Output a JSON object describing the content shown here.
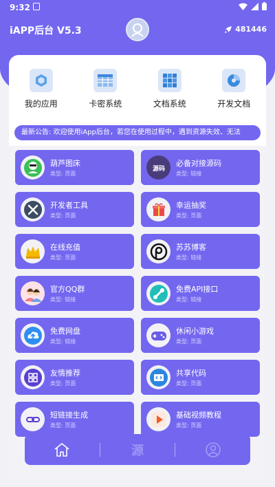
{
  "status_bar": {
    "time": "9:32",
    "notification_icon": "a-icon",
    "icons": [
      "wifi-icon",
      "signal-icon",
      "battery-icon"
    ]
  },
  "header": {
    "title": "iAPP后台 V5.3",
    "online_count": "481446",
    "avatar_icon": "user-avatar-icon",
    "online_icon": "rocket-icon"
  },
  "quick_links": [
    {
      "label": "我的应用",
      "icon": "app-cube-icon"
    },
    {
      "label": "卡密系统",
      "icon": "table-icon"
    },
    {
      "label": "文档系统",
      "icon": "grid-icon"
    },
    {
      "label": "开发文档",
      "icon": "doc-icon"
    }
  ],
  "notice": "最新公告:  欢迎使用iApp后台，若您在使用过程中，遇到资源失效、无法",
  "cards": [
    {
      "title": "葫芦图床",
      "type": "类型: 页面",
      "icon": "gourd-icon"
    },
    {
      "title": "必备对接源码",
      "type": "类型: 链接",
      "icon": "source-code-icon"
    },
    {
      "title": "开发者工具",
      "type": "类型: 页面",
      "icon": "tools-icon"
    },
    {
      "title": "幸运抽奖",
      "type": "类型: 页面",
      "icon": "gift-icon"
    },
    {
      "title": "在线充值",
      "type": "类型: 页面",
      "icon": "crown-icon"
    },
    {
      "title": "苏苏博客",
      "type": "类型: 链接",
      "icon": "blog-icon"
    },
    {
      "title": "官方QQ群",
      "type": "类型: 链接",
      "icon": "qq-group-icon"
    },
    {
      "title": "免费API接口",
      "type": "类型: 链接",
      "icon": "api-plug-icon"
    },
    {
      "title": "免费网盘",
      "type": "类型: 链接",
      "icon": "cloud-upload-icon"
    },
    {
      "title": "休闲小游戏",
      "type": "类型: 页面",
      "icon": "gamepad-icon"
    },
    {
      "title": "友情推荐",
      "type": "类型: 页面",
      "icon": "apps-icon"
    },
    {
      "title": "共享代码",
      "type": "类型: 页面",
      "icon": "code-icon"
    },
    {
      "title": "短链接生成",
      "type": "类型: 页面",
      "icon": "link-icon"
    },
    {
      "title": "基础视频教程",
      "type": "类型: 页面",
      "icon": "play-icon"
    }
  ],
  "bottom_nav": {
    "home_icon": "home-icon",
    "center_label": "源",
    "profile_icon": "profile-icon"
  },
  "colors": {
    "primary": "#7367f0",
    "background": "#f2f2f6"
  }
}
